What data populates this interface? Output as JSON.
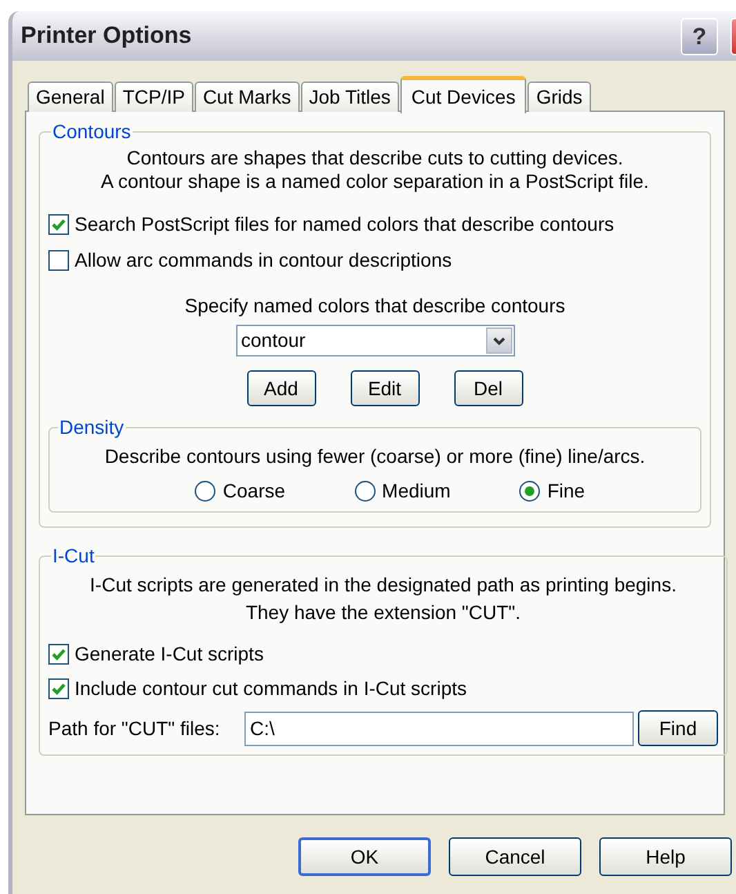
{
  "window": {
    "title": "Printer Options",
    "help_button": "?"
  },
  "tabs": [
    {
      "label": "General",
      "selected": false
    },
    {
      "label": "TCP/IP",
      "selected": false
    },
    {
      "label": "Cut Marks",
      "selected": false
    },
    {
      "label": "Job Titles",
      "selected": false
    },
    {
      "label": "Cut Devices",
      "selected": true
    },
    {
      "label": "Grids",
      "selected": false
    }
  ],
  "contours": {
    "legend": "Contours",
    "description": [
      "Contours are shapes that describe cuts to cutting devices.",
      "A contour shape is a named color separation in a PostScript file."
    ],
    "checkboxes": [
      {
        "label": "Search PostScript files for named colors that describe contours",
        "checked": true
      },
      {
        "label": "Allow arc commands in contour descriptions",
        "checked": false
      }
    ],
    "colors_label": "Specify named colors that describe contours",
    "color_select": {
      "value": "contour"
    },
    "buttons": [
      "Add",
      "Edit",
      "Del"
    ],
    "density": {
      "legend": "Density",
      "description": "Describe contours using fewer (coarse) or more (fine) line/arcs.",
      "options": [
        {
          "label": "Coarse",
          "selected": false
        },
        {
          "label": "Medium",
          "selected": false
        },
        {
          "label": "Fine",
          "selected": true
        }
      ]
    }
  },
  "icut": {
    "legend": "I-Cut",
    "description": [
      "I-Cut scripts are generated in the designated path as printing begins.",
      "They have the extension \"CUT\"."
    ],
    "checkboxes": [
      {
        "label": "Generate I-Cut scripts",
        "checked": true
      },
      {
        "label": "Include contour cut commands in I-Cut scripts",
        "checked": true
      }
    ],
    "path_label": "Path for \"CUT\" files:",
    "path_value": "C:\\",
    "find_button": "Find"
  },
  "buttons": [
    "OK",
    "Cancel",
    "Help"
  ]
}
